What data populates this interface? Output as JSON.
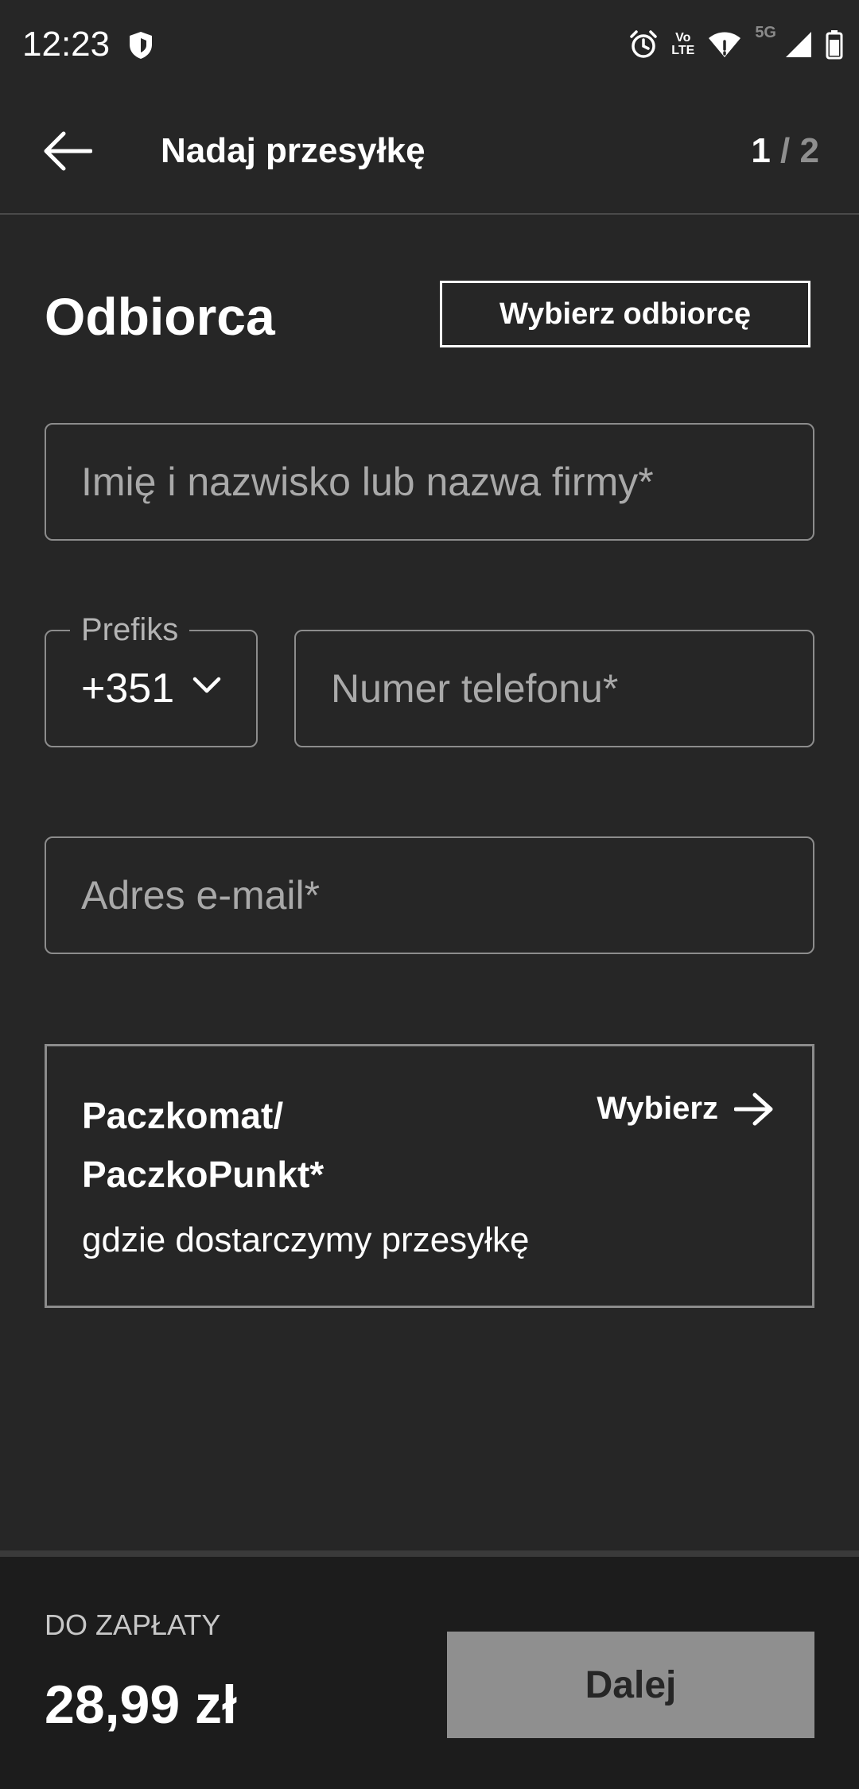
{
  "status_bar": {
    "time": "12:23",
    "volte_top": "Vo",
    "volte_bottom": "LTE",
    "network": "5G",
    "icons": [
      "shield-icon",
      "alarm-icon",
      "volte-icon",
      "wifi-icon",
      "signal-icon",
      "battery-icon"
    ]
  },
  "app_bar": {
    "title": "Nadaj przesyłkę",
    "step_current": "1",
    "step_separator": "/",
    "step_total": "2"
  },
  "recipient": {
    "section_title": "Odbiorca",
    "choose_button": "Wybierz odbiorcę"
  },
  "form": {
    "name_placeholder": "Imię i nazwisko lub nazwa firmy*",
    "name_value": "",
    "prefix_label": "Prefiks",
    "prefix_value": "+351",
    "phone_placeholder": "Numer telefonu*",
    "phone_value": "",
    "email_placeholder": "Adres e-mail*",
    "email_value": ""
  },
  "locker": {
    "title_line1": "Paczkomat/",
    "title_line2": "PaczkoPunkt*",
    "subtitle": "gdzie dostarczymy przesyłkę",
    "choose_label": "Wybierz"
  },
  "footer": {
    "pay_label": "DO ZAPŁATY",
    "amount": "28,99 zł",
    "next_label": "Dalej"
  },
  "colors": {
    "background": "#262626",
    "footer_background": "#1c1c1c",
    "border": "#8c8c8c",
    "disabled_button": "#8f8f8f",
    "text": "#ffffff"
  }
}
